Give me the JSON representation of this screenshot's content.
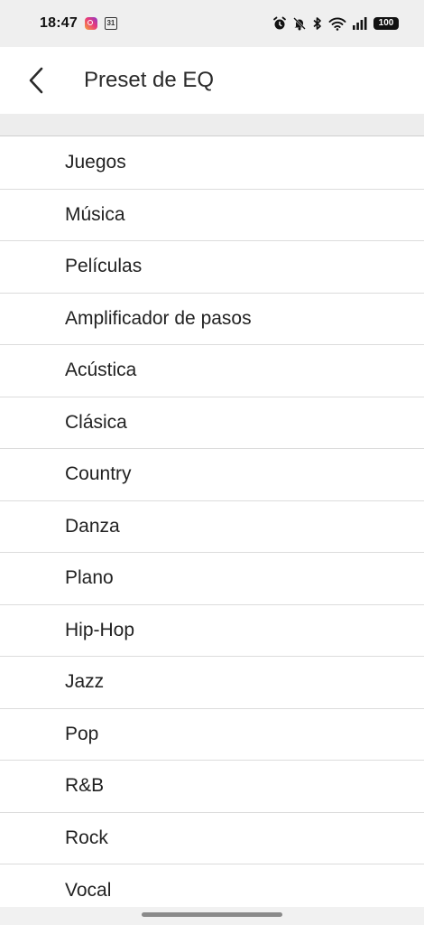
{
  "status_bar": {
    "time": "18:47",
    "calendar_badge": "31",
    "battery": "100",
    "icons": [
      "instagram-icon",
      "calendar-icon",
      "alarm-icon",
      "bell-off-icon",
      "bluetooth-icon",
      "wifi-icon",
      "signal-icon",
      "battery-icon"
    ]
  },
  "header": {
    "back_icon": "chevron-left-icon",
    "title": "Preset de EQ"
  },
  "presets": [
    {
      "label": "Juegos"
    },
    {
      "label": "Música"
    },
    {
      "label": "Películas"
    },
    {
      "label": "Amplificador de pasos"
    },
    {
      "label": "Acústica"
    },
    {
      "label": "Clásica"
    },
    {
      "label": "Country"
    },
    {
      "label": "Danza"
    },
    {
      "label": "Plano"
    },
    {
      "label": "Hip-Hop"
    },
    {
      "label": "Jazz"
    },
    {
      "label": "Pop"
    },
    {
      "label": "R&B"
    },
    {
      "label": "Rock"
    },
    {
      "label": "Vocal"
    }
  ]
}
